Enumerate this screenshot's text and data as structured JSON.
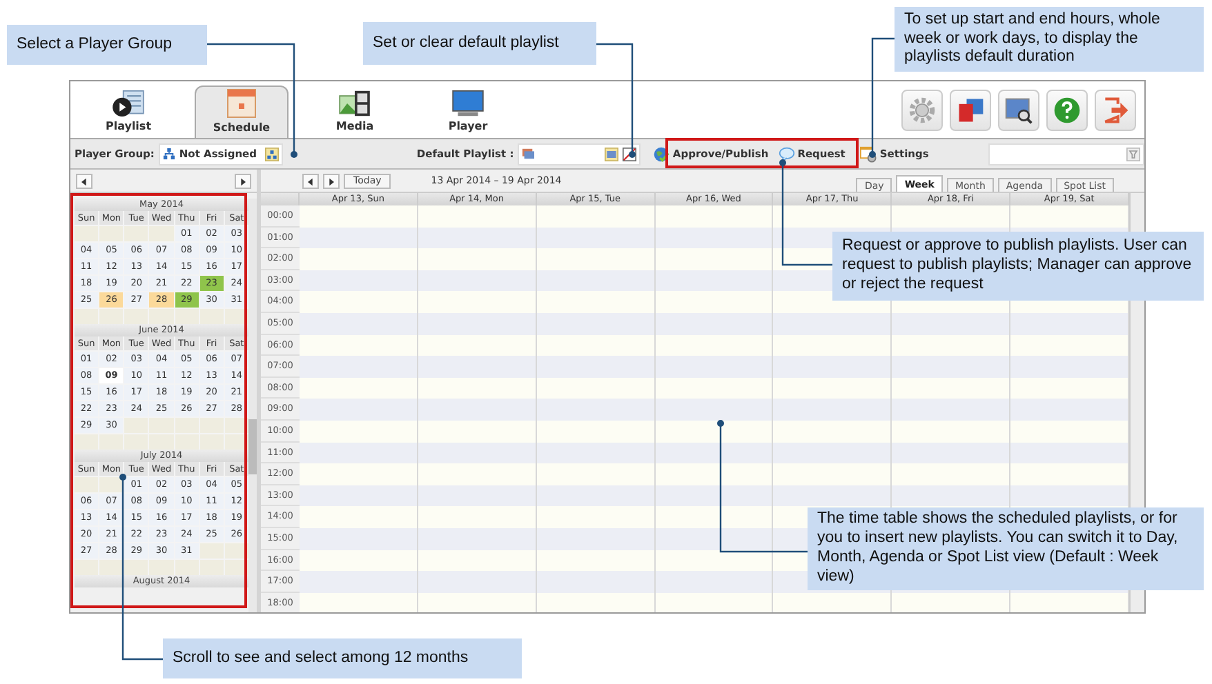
{
  "tabs": [
    {
      "label": "Playlist",
      "selected": false
    },
    {
      "label": "Schedule",
      "selected": true
    },
    {
      "label": "Media",
      "selected": false
    },
    {
      "label": "Player",
      "selected": false
    }
  ],
  "toolbar": {
    "player_group_label": "Player Group:",
    "player_group_value": "Not Assigned",
    "default_playlist_label": "Default Playlist :",
    "approve_button": "Approve/Publish",
    "request_button": "Request",
    "settings_button": "Settings"
  },
  "calendar": {
    "months": [
      {
        "title": "May 2014",
        "weekdays": [
          "Sun",
          "Mon",
          "Tue",
          "Wed",
          "Thu",
          "Fri",
          "Sat"
        ],
        "weeks": [
          [
            {
              "day": "01"
            },
            {
              "day": "02"
            },
            {
              "day": "03"
            }
          ],
          [
            {
              "day": "04"
            },
            {
              "day": "05"
            },
            {
              "day": "06"
            },
            {
              "day": "07"
            },
            {
              "day": "08"
            },
            {
              "day": "09"
            },
            {
              "day": "10"
            }
          ],
          [
            {
              "day": "11"
            },
            {
              "day": "12"
            },
            {
              "day": "13"
            },
            {
              "day": "14"
            },
            {
              "day": "15"
            },
            {
              "day": "16"
            },
            {
              "day": "17"
            }
          ],
          [
            {
              "day": "18"
            },
            {
              "day": "19"
            },
            {
              "day": "20"
            },
            {
              "day": "21"
            },
            {
              "day": "22"
            },
            {
              "day": "23",
              "kind": "approved"
            },
            {
              "day": "24"
            }
          ],
          [
            {
              "day": "25"
            },
            {
              "day": "26",
              "kind": "pending"
            },
            {
              "day": "27"
            },
            {
              "day": "28",
              "kind": "pending"
            },
            {
              "day": "29",
              "kind": "approved"
            },
            {
              "day": "30"
            },
            {
              "day": "31"
            }
          ]
        ]
      },
      {
        "title": "June 2014",
        "weekdays": [
          "Sun",
          "Mon",
          "Tue",
          "Wed",
          "Thu",
          "Fri",
          "Sat"
        ],
        "weeks": [
          [
            {
              "day": "01"
            },
            {
              "day": "02"
            },
            {
              "day": "03"
            },
            {
              "day": "04"
            },
            {
              "day": "05"
            },
            {
              "day": "06"
            },
            {
              "day": "07"
            }
          ],
          [
            {
              "day": "08"
            },
            {
              "day": "09",
              "kind": "today"
            },
            {
              "day": "10"
            },
            {
              "day": "11"
            },
            {
              "day": "12"
            },
            {
              "day": "13"
            },
            {
              "day": "14"
            }
          ],
          [
            {
              "day": "15"
            },
            {
              "day": "16"
            },
            {
              "day": "17"
            },
            {
              "day": "18"
            },
            {
              "day": "19"
            },
            {
              "day": "20"
            },
            {
              "day": "21"
            }
          ],
          [
            {
              "day": "22"
            },
            {
              "day": "23"
            },
            {
              "day": "24"
            },
            {
              "day": "25"
            },
            {
              "day": "26"
            },
            {
              "day": "27"
            },
            {
              "day": "28"
            }
          ],
          [
            {
              "day": "29"
            },
            {
              "day": "30"
            }
          ]
        ]
      },
      {
        "title": "July 2014",
        "weekdays": [
          "Sun",
          "Mon",
          "Tue",
          "Wed",
          "Thu",
          "Fri",
          "Sat"
        ],
        "weeks": [
          [
            {
              "day": "01"
            },
            {
              "day": "02"
            },
            {
              "day": "03"
            },
            {
              "day": "04"
            },
            {
              "day": "05"
            }
          ],
          [
            {
              "day": "06"
            },
            {
              "day": "07"
            },
            {
              "day": "08"
            },
            {
              "day": "09"
            },
            {
              "day": "10"
            },
            {
              "day": "11"
            },
            {
              "day": "12"
            }
          ],
          [
            {
              "day": "13"
            },
            {
              "day": "14"
            },
            {
              "day": "15"
            },
            {
              "day": "16"
            },
            {
              "day": "17"
            },
            {
              "day": "18"
            },
            {
              "day": "19"
            }
          ],
          [
            {
              "day": "20"
            },
            {
              "day": "21"
            },
            {
              "day": "22"
            },
            {
              "day": "23"
            },
            {
              "day": "24"
            },
            {
              "day": "25"
            },
            {
              "day": "26"
            }
          ],
          [
            {
              "day": "27"
            },
            {
              "day": "28"
            },
            {
              "day": "29"
            },
            {
              "day": "30"
            },
            {
              "day": "31"
            }
          ]
        ]
      }
    ],
    "next_month_title": "August 2014"
  },
  "week_view": {
    "today_button": "Today",
    "range": "13 Apr 2014 – 19 Apr 2014",
    "view_tabs": [
      {
        "label": "Day",
        "selected": false
      },
      {
        "label": "Week",
        "selected": true
      },
      {
        "label": "Month",
        "selected": false
      },
      {
        "label": "Agenda",
        "selected": false
      },
      {
        "label": "Spot List",
        "selected": false
      }
    ],
    "columns": [
      "Apr 13, Sun",
      "Apr 14, Mon",
      "Apr 15, Tue",
      "Apr 16, Wed",
      "Apr 17, Thu",
      "Apr 18, Fri",
      "Apr 19, Sat"
    ],
    "times": [
      "00:00",
      "01:00",
      "02:00",
      "03:00",
      "04:00",
      "05:00",
      "06:00",
      "07:00",
      "08:00",
      "09:00",
      "10:00",
      "11:00",
      "12:00",
      "13:00",
      "14:00",
      "15:00",
      "16:00",
      "17:00",
      "18:00"
    ]
  },
  "callouts": [
    "Select a Player Group",
    "Set or clear default playlist",
    "To set up start and end hours, whole week or work days, to display the playlists default duration",
    "Request or approve to publish playlists. User can request to publish playlists; Manager can approve or reject the request",
    "The time table shows the scheduled playlists, or for you to insert new playlists. You can switch it to Day, Month, Agenda or Spot List view (Default : Week view)",
    "Scroll to see and select among 12 months"
  ]
}
